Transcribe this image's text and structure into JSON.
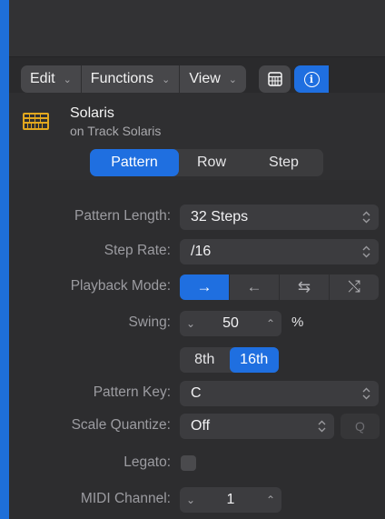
{
  "toolbar": {
    "edit_label": "Edit",
    "functions_label": "Functions",
    "view_label": "View",
    "chevron": "⌄",
    "inspector_icon": "info-icon",
    "grid_icon": "step-grid-icon",
    "accent_color": "#1f6fe0"
  },
  "region": {
    "name": "Solaris",
    "track": "on Track Solaris",
    "icon": "step-sequencer-pattern-icon"
  },
  "tabs": [
    "Pattern",
    "Row",
    "Step"
  ],
  "tabs_active": "Pattern",
  "form": {
    "pattern_length": {
      "label": "Pattern Length:",
      "value": "32 Steps"
    },
    "step_rate": {
      "label": "Step Rate:",
      "value": "/16"
    },
    "playback_mode": {
      "label": "Playback Mode:",
      "options": [
        "→",
        "←",
        "⇆",
        "⤭"
      ],
      "option_icons": [
        "forward-arrow-icon",
        "reverse-arrow-icon",
        "ping-pong-icon",
        "random-icon"
      ],
      "selected": "→"
    },
    "swing": {
      "label": "Swing:",
      "value": "50",
      "unit": "%",
      "down": "⌄",
      "up": "⌃"
    },
    "swing_resolution": {
      "options": [
        "8th",
        "16th"
      ],
      "selected": "16th"
    },
    "pattern_key": {
      "label": "Pattern Key:",
      "value": "C"
    },
    "scale_quantize": {
      "label": "Scale Quantize:",
      "value": "Off",
      "q_label": "Q"
    },
    "legato": {
      "label": "Legato:",
      "checked": false
    },
    "midi_channel": {
      "label": "MIDI Channel:",
      "value": "1",
      "down": "⌄",
      "up": "⌃"
    }
  }
}
